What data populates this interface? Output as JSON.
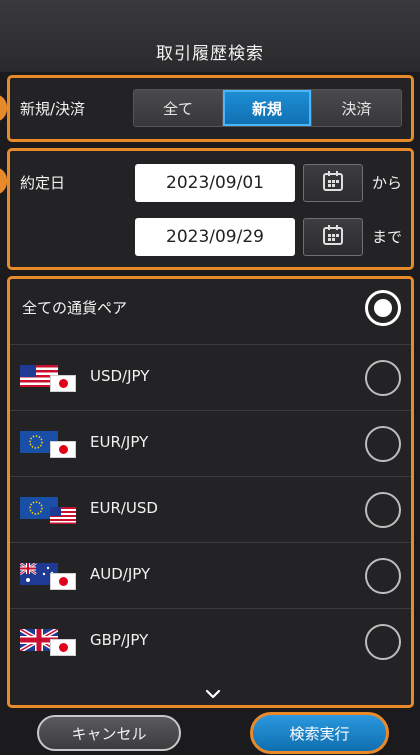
{
  "header": {
    "title": "取引履歴検索"
  },
  "trade_type": {
    "label": "新規/決済",
    "options": [
      "全て",
      "新規",
      "決済"
    ],
    "selected": "新規"
  },
  "contract_date": {
    "label": "約定日",
    "from_value": "2023/09/01",
    "from_suffix": "から",
    "to_value": "2023/09/29",
    "to_suffix": "まで"
  },
  "currency_pairs": {
    "all_label": "全ての通貨ペア",
    "selected": "全ての通貨ペア",
    "items": [
      {
        "label": "USD/JPY",
        "base_flag": "us-flag-icon",
        "quote_flag": "jp-flag-icon"
      },
      {
        "label": "EUR/JPY",
        "base_flag": "eu-flag-icon",
        "quote_flag": "jp-flag-icon"
      },
      {
        "label": "EUR/USD",
        "base_flag": "eu-flag-icon",
        "quote_flag": "us-flag-icon"
      },
      {
        "label": "AUD/JPY",
        "base_flag": "au-flag-icon",
        "quote_flag": "jp-flag-icon"
      },
      {
        "label": "GBP/JPY",
        "base_flag": "gb-flag-icon",
        "quote_flag": "jp-flag-icon"
      }
    ]
  },
  "footer": {
    "cancel_label": "キャンセル",
    "search_label": "検索実行"
  },
  "colors": {
    "accent": "#e98a2a",
    "selected": "#1e8fd6",
    "background": "#1b1b1d"
  }
}
